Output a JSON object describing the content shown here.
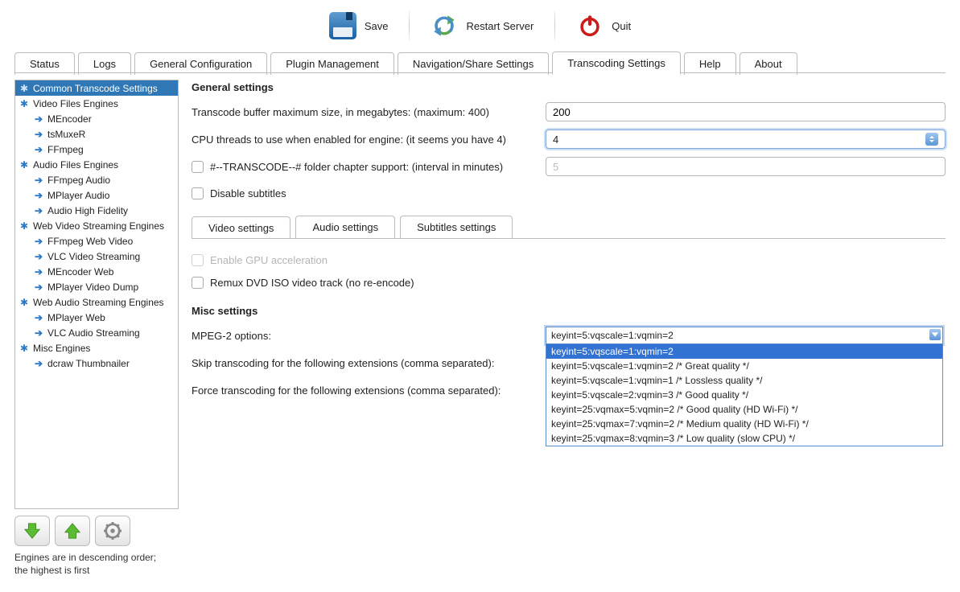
{
  "toolbar": {
    "save_label": "Save",
    "restart_label": "Restart Server",
    "quit_label": "Quit"
  },
  "main_tabs": {
    "status": "Status",
    "logs": "Logs",
    "genconf": "General Configuration",
    "plugin": "Plugin Management",
    "nav": "Navigation/Share Settings",
    "transcode": "Transcoding Settings",
    "help": "Help",
    "about": "About"
  },
  "tree": {
    "n0": "Common Transcode Settings",
    "n1": "Video Files Engines",
    "n1a": "MEncoder",
    "n1b": "tsMuxeR",
    "n1c": "FFmpeg",
    "n2": "Audio Files Engines",
    "n2a": "FFmpeg Audio",
    "n2b": "MPlayer Audio",
    "n2c": "Audio High Fidelity",
    "n3": "Web Video Streaming Engines",
    "n3a": "FFmpeg Web Video",
    "n3b": "VLC Video Streaming",
    "n3c": "MEncoder Web",
    "n3d": "MPlayer Video Dump",
    "n4": "Web Audio Streaming Engines",
    "n4a": "MPlayer Web",
    "n4b": "VLC Audio Streaming",
    "n5": "Misc Engines",
    "n5a": "dcraw Thumbnailer"
  },
  "side_note": "Engines are in descending order; the highest is first",
  "general": {
    "heading": "General settings",
    "buffer_label": "Transcode buffer maximum size, in megabytes: (maximum: 400)",
    "buffer_value": "200",
    "cpu_label": "CPU threads to use when enabled for engine: (it seems you have 4)",
    "cpu_value": "4",
    "chapter_label": "#--TRANSCODE--# folder chapter support: (interval in minutes)",
    "chapter_value": "5",
    "disable_subs": "Disable subtitles"
  },
  "subtabs": {
    "video": "Video settings",
    "audio": "Audio settings",
    "subs": "Subtitles settings"
  },
  "video": {
    "gpu": "Enable GPU acceleration",
    "remux": "Remux DVD ISO video track (no re-encode)"
  },
  "misc": {
    "heading": "Misc settings",
    "mpeg2_label": "MPEG-2 options:",
    "mpeg2_value": "keyint=5:vqscale=1:vqmin=2",
    "skip_label": "Skip transcoding for the following extensions (comma separated):",
    "force_label": "Force transcoding for the following extensions (comma separated):",
    "options": [
      "keyint=5:vqscale=1:vqmin=2",
      "keyint=5:vqscale=1:vqmin=2  /* Great quality */",
      "keyint=5:vqscale=1:vqmin=1  /* Lossless quality */",
      "keyint=5:vqscale=2:vqmin=3  /* Good quality */",
      "keyint=25:vqmax=5:vqmin=2  /* Good quality (HD Wi-Fi) */",
      "keyint=25:vqmax=7:vqmin=2  /* Medium quality (HD Wi-Fi) */",
      "keyint=25:vqmax=8:vqmin=3  /* Low quality (slow CPU) */"
    ]
  }
}
